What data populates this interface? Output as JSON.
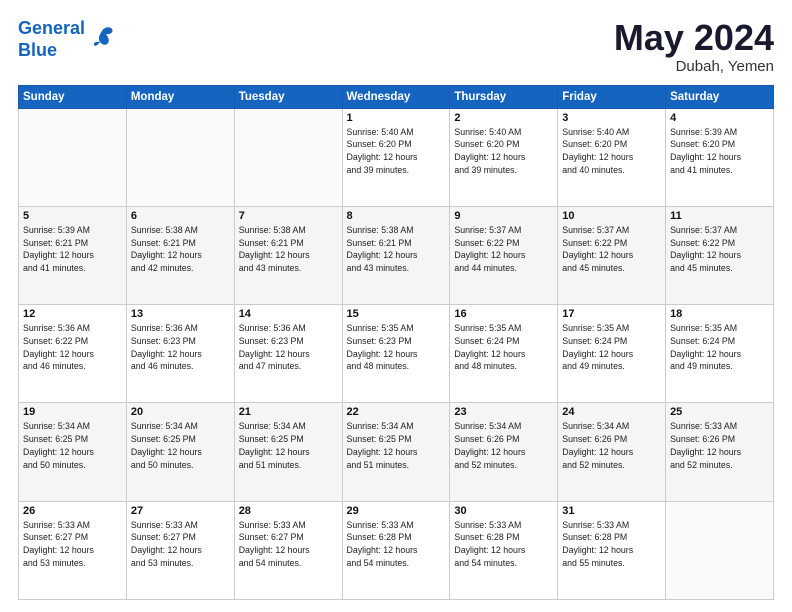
{
  "header": {
    "logo_line1": "General",
    "logo_line2": "Blue",
    "month": "May 2024",
    "location": "Dubah, Yemen"
  },
  "days_of_week": [
    "Sunday",
    "Monday",
    "Tuesday",
    "Wednesday",
    "Thursday",
    "Friday",
    "Saturday"
  ],
  "weeks": [
    [
      {
        "num": "",
        "info": ""
      },
      {
        "num": "",
        "info": ""
      },
      {
        "num": "",
        "info": ""
      },
      {
        "num": "1",
        "info": "Sunrise: 5:40 AM\nSunset: 6:20 PM\nDaylight: 12 hours\nand 39 minutes."
      },
      {
        "num": "2",
        "info": "Sunrise: 5:40 AM\nSunset: 6:20 PM\nDaylight: 12 hours\nand 39 minutes."
      },
      {
        "num": "3",
        "info": "Sunrise: 5:40 AM\nSunset: 6:20 PM\nDaylight: 12 hours\nand 40 minutes."
      },
      {
        "num": "4",
        "info": "Sunrise: 5:39 AM\nSunset: 6:20 PM\nDaylight: 12 hours\nand 41 minutes."
      }
    ],
    [
      {
        "num": "5",
        "info": "Sunrise: 5:39 AM\nSunset: 6:21 PM\nDaylight: 12 hours\nand 41 minutes."
      },
      {
        "num": "6",
        "info": "Sunrise: 5:38 AM\nSunset: 6:21 PM\nDaylight: 12 hours\nand 42 minutes."
      },
      {
        "num": "7",
        "info": "Sunrise: 5:38 AM\nSunset: 6:21 PM\nDaylight: 12 hours\nand 43 minutes."
      },
      {
        "num": "8",
        "info": "Sunrise: 5:38 AM\nSunset: 6:21 PM\nDaylight: 12 hours\nand 43 minutes."
      },
      {
        "num": "9",
        "info": "Sunrise: 5:37 AM\nSunset: 6:22 PM\nDaylight: 12 hours\nand 44 minutes."
      },
      {
        "num": "10",
        "info": "Sunrise: 5:37 AM\nSunset: 6:22 PM\nDaylight: 12 hours\nand 45 minutes."
      },
      {
        "num": "11",
        "info": "Sunrise: 5:37 AM\nSunset: 6:22 PM\nDaylight: 12 hours\nand 45 minutes."
      }
    ],
    [
      {
        "num": "12",
        "info": "Sunrise: 5:36 AM\nSunset: 6:22 PM\nDaylight: 12 hours\nand 46 minutes."
      },
      {
        "num": "13",
        "info": "Sunrise: 5:36 AM\nSunset: 6:23 PM\nDaylight: 12 hours\nand 46 minutes."
      },
      {
        "num": "14",
        "info": "Sunrise: 5:36 AM\nSunset: 6:23 PM\nDaylight: 12 hours\nand 47 minutes."
      },
      {
        "num": "15",
        "info": "Sunrise: 5:35 AM\nSunset: 6:23 PM\nDaylight: 12 hours\nand 48 minutes."
      },
      {
        "num": "16",
        "info": "Sunrise: 5:35 AM\nSunset: 6:24 PM\nDaylight: 12 hours\nand 48 minutes."
      },
      {
        "num": "17",
        "info": "Sunrise: 5:35 AM\nSunset: 6:24 PM\nDaylight: 12 hours\nand 49 minutes."
      },
      {
        "num": "18",
        "info": "Sunrise: 5:35 AM\nSunset: 6:24 PM\nDaylight: 12 hours\nand 49 minutes."
      }
    ],
    [
      {
        "num": "19",
        "info": "Sunrise: 5:34 AM\nSunset: 6:25 PM\nDaylight: 12 hours\nand 50 minutes."
      },
      {
        "num": "20",
        "info": "Sunrise: 5:34 AM\nSunset: 6:25 PM\nDaylight: 12 hours\nand 50 minutes."
      },
      {
        "num": "21",
        "info": "Sunrise: 5:34 AM\nSunset: 6:25 PM\nDaylight: 12 hours\nand 51 minutes."
      },
      {
        "num": "22",
        "info": "Sunrise: 5:34 AM\nSunset: 6:25 PM\nDaylight: 12 hours\nand 51 minutes."
      },
      {
        "num": "23",
        "info": "Sunrise: 5:34 AM\nSunset: 6:26 PM\nDaylight: 12 hours\nand 52 minutes."
      },
      {
        "num": "24",
        "info": "Sunrise: 5:34 AM\nSunset: 6:26 PM\nDaylight: 12 hours\nand 52 minutes."
      },
      {
        "num": "25",
        "info": "Sunrise: 5:33 AM\nSunset: 6:26 PM\nDaylight: 12 hours\nand 52 minutes."
      }
    ],
    [
      {
        "num": "26",
        "info": "Sunrise: 5:33 AM\nSunset: 6:27 PM\nDaylight: 12 hours\nand 53 minutes."
      },
      {
        "num": "27",
        "info": "Sunrise: 5:33 AM\nSunset: 6:27 PM\nDaylight: 12 hours\nand 53 minutes."
      },
      {
        "num": "28",
        "info": "Sunrise: 5:33 AM\nSunset: 6:27 PM\nDaylight: 12 hours\nand 54 minutes."
      },
      {
        "num": "29",
        "info": "Sunrise: 5:33 AM\nSunset: 6:28 PM\nDaylight: 12 hours\nand 54 minutes."
      },
      {
        "num": "30",
        "info": "Sunrise: 5:33 AM\nSunset: 6:28 PM\nDaylight: 12 hours\nand 54 minutes."
      },
      {
        "num": "31",
        "info": "Sunrise: 5:33 AM\nSunset: 6:28 PM\nDaylight: 12 hours\nand 55 minutes."
      },
      {
        "num": "",
        "info": ""
      }
    ]
  ]
}
